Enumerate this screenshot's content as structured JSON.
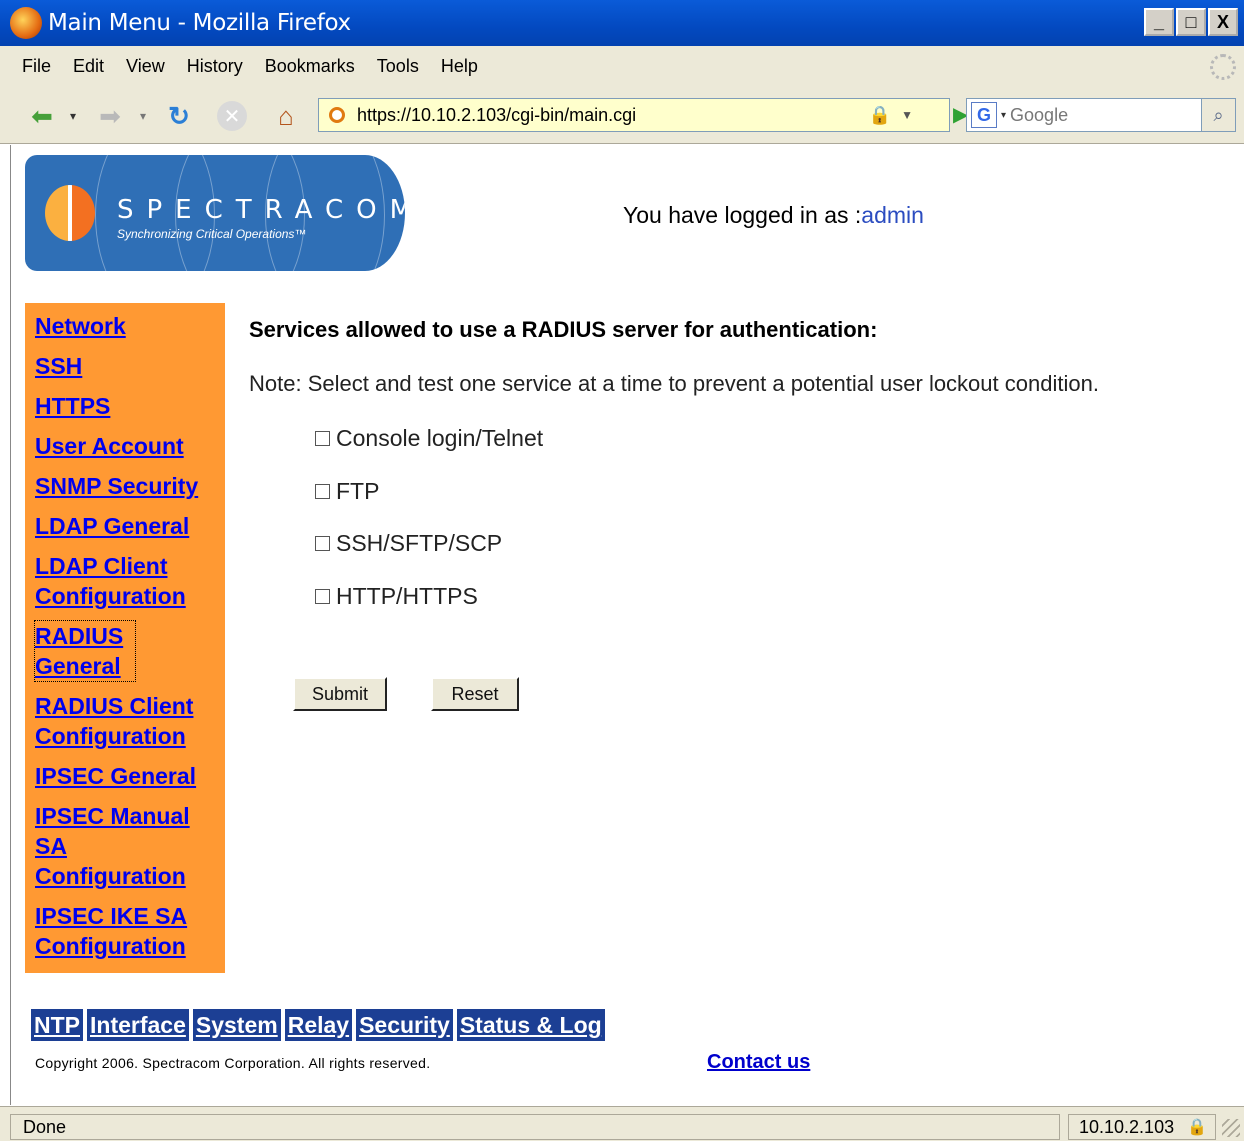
{
  "window": {
    "title": "Main Menu - Mozilla Firefox",
    "buttons": [
      "_",
      "□",
      "X"
    ]
  },
  "menubar": {
    "items": [
      "File",
      "Edit",
      "View",
      "History",
      "Bookmarks",
      "Tools",
      "Help"
    ]
  },
  "navbar": {
    "url": "https://10.10.2.103/cgi-bin/main.cgi",
    "search_engine_glyph": "G",
    "search_placeholder": "Google"
  },
  "header": {
    "brand": "SPECTRACOM",
    "tagline": "Synchronizing Critical Operations™",
    "login_prefix": "You have logged in as :",
    "login_user": "admin"
  },
  "sidebar": {
    "items": [
      {
        "label": "Network"
      },
      {
        "label": "SSH"
      },
      {
        "label": "HTTPS"
      },
      {
        "label": "User Account"
      },
      {
        "label": "SNMP Security"
      },
      {
        "label": "LDAP General"
      },
      {
        "label": "LDAP Client Configuration"
      },
      {
        "label": "RADIUS General"
      },
      {
        "label": "RADIUS Client Configuration"
      },
      {
        "label": "IPSEC General"
      },
      {
        "label": "IPSEC Manual SA Configuration"
      },
      {
        "label": "IPSEC IKE SA Configuration"
      }
    ]
  },
  "form": {
    "title": "Services allowed to use a RADIUS server for authentication:",
    "note": "Note: Select and test one service at a time to prevent a potential user lockout condition.",
    "options": [
      {
        "label": "Console login/Telnet",
        "checked": false
      },
      {
        "label": "FTP",
        "checked": false
      },
      {
        "label": "SSH/SFTP/SCP",
        "checked": false
      },
      {
        "label": "HTTP/HTTPS",
        "checked": false
      }
    ],
    "submit_label": "Submit",
    "reset_label": "Reset"
  },
  "bottom_nav": {
    "items": [
      "NTP",
      "Interface",
      "System",
      "Relay",
      "Security",
      "Status & Log"
    ]
  },
  "footer": {
    "copyright": "Copyright 2006. Spectracom Corporation. All rights reserved.",
    "contact": "Contact us"
  },
  "statusbar": {
    "status": "Done",
    "host": "10.10.2.103"
  },
  "colors": {
    "sidebar_bg": "#ff9933",
    "bottom_nav_bg": "#1c3f94",
    "link": "#0000ee",
    "logo_bg": "#2f6fb6"
  }
}
